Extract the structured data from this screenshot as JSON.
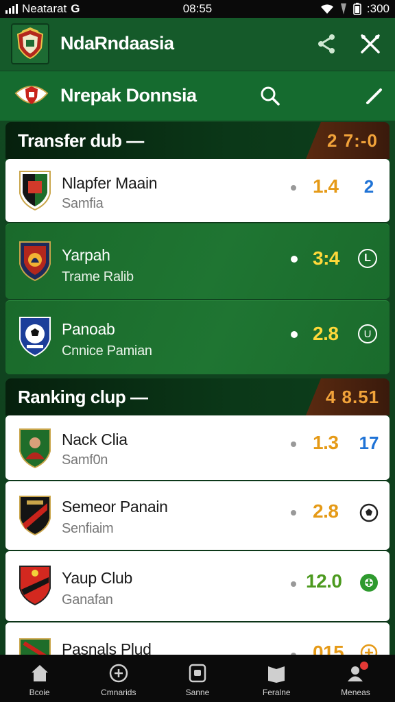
{
  "status_bar": {
    "carrier": "Neatarat",
    "g_label": "G",
    "time": "08:55",
    "battery_text": ":300"
  },
  "app_bar": {
    "title": "NdaRndaasia"
  },
  "sub_header": {
    "title": "Nrepak Donnsia"
  },
  "transfer_section": {
    "title": "Transfer dub —",
    "score": "2 7:-0",
    "rows": [
      {
        "name": "Nlapfer Maain",
        "sub": "Samfia",
        "value": "1.4",
        "trail": "2",
        "value_color": "#e59a17",
        "trail_color": "#1f73d6",
        "style": "light",
        "crest": "crest-green-black"
      },
      {
        "name": "Yarpah",
        "sub": "Trame Ralib",
        "value": "3:4",
        "trail": "L",
        "value_color": "#ffd93a",
        "trail_color": "#ffffff",
        "style": "dark",
        "crest": "crest-red-navy"
      },
      {
        "name": "Panoab",
        "sub": "Cnnice Pamian",
        "value": "2.8",
        "trail": "U",
        "value_color": "#ffd93a",
        "trail_color": "#ffffff",
        "style": "dark",
        "crest": "crest-blue-ball"
      }
    ]
  },
  "ranking_section": {
    "title": "Ranking clup —",
    "score": "4 8.51",
    "rows": [
      {
        "name": "Nack Clia",
        "sub": "Samf0n",
        "value": "1.3",
        "trail": "17",
        "value_color": "#e59a17",
        "trail_color": "#1f73d6",
        "style": "light",
        "crest": "crest-player"
      },
      {
        "name": "Semeor Panain",
        "sub": "Senfiaim",
        "value": "2.8",
        "trail": "",
        "value_color": "#e59a17",
        "trail_color": "#222222",
        "style": "light",
        "crest": "crest-black-red"
      },
      {
        "name": "Yaup Club",
        "sub": "Ganafan",
        "value": "12.0",
        "trail": "",
        "value_color": "#4c9a1f",
        "trail_color": "#2e9a2e",
        "style": "light",
        "crest": "crest-red-shield"
      },
      {
        "name": "Pasnals Plud",
        "sub": "",
        "value": "015",
        "trail": "",
        "value_color": "#e59a17",
        "trail_color": "#e59a17",
        "style": "light",
        "crest": "crest-green-red"
      }
    ]
  },
  "bottom_nav": [
    {
      "label": "Bcoie",
      "icon": "home-icon"
    },
    {
      "label": "Cmnarids",
      "icon": "compass-icon"
    },
    {
      "label": "Sanne",
      "icon": "calendar-icon"
    },
    {
      "label": "Feralne",
      "icon": "book-icon"
    },
    {
      "label": "Meneas",
      "icon": "profile-icon"
    }
  ],
  "colors": {
    "accent_green": "#155a2a",
    "header_green": "#156b2f",
    "orange": "#f2a33a"
  }
}
